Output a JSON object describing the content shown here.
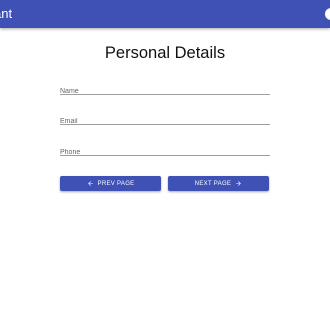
{
  "appbar": {
    "title": "ant",
    "color": "#3f51b5"
  },
  "page": {
    "title": "Personal Details"
  },
  "form": {
    "fields": [
      {
        "placeholder": "Name",
        "value": ""
      },
      {
        "placeholder": "Email",
        "value": ""
      },
      {
        "placeholder": "Phone",
        "value": ""
      }
    ]
  },
  "buttons": {
    "prev_label": "PREV PAGE",
    "next_label": "NEXT PAGE",
    "prev_icon": "arrow-left-icon",
    "next_icon": "arrow-right-icon"
  }
}
